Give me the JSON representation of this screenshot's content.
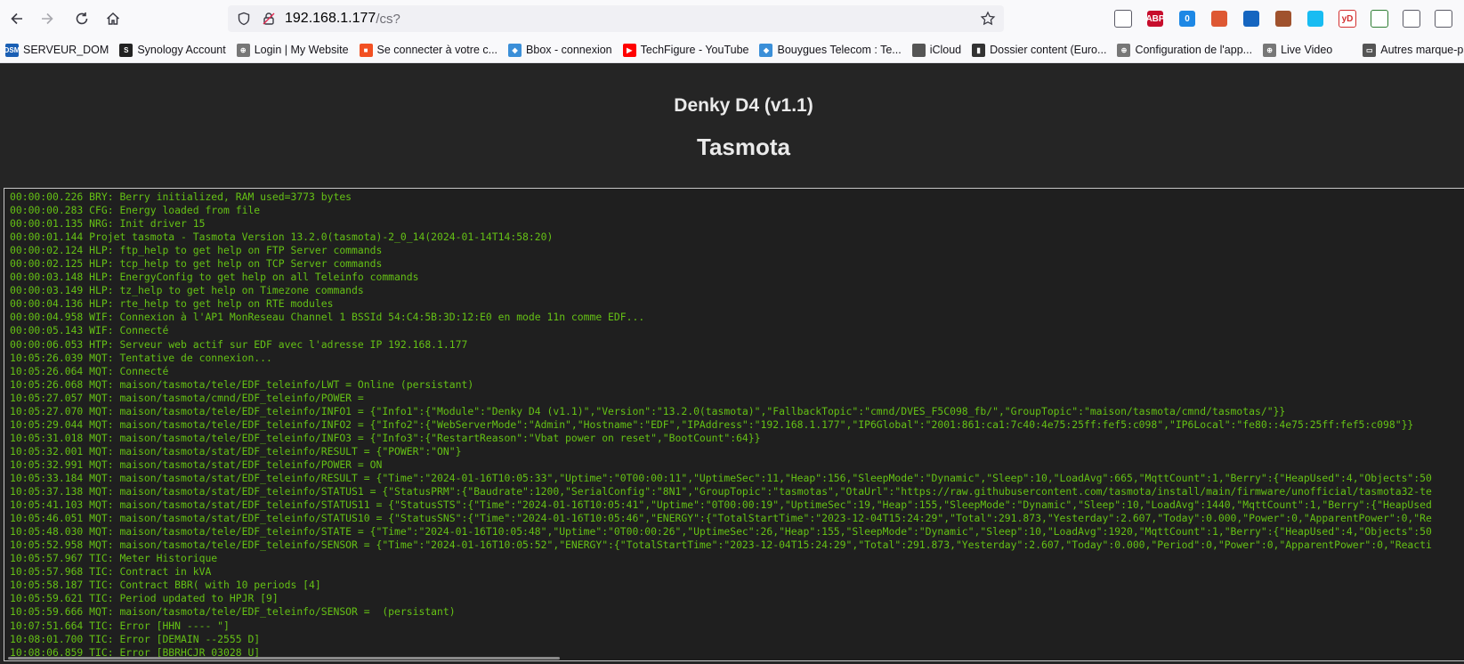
{
  "browser": {
    "url_host": "192.168.1.177",
    "url_path": "/cs?",
    "extensions": [
      {
        "name": "pocket-icon",
        "label": "",
        "color": "#ffffff",
        "fg": "#5b5b66"
      },
      {
        "name": "adblock-icon",
        "label": "ABP",
        "color": "#c70d2c",
        "fg": "#ffffff"
      },
      {
        "name": "clipboard-extension-icon",
        "label": "0",
        "color": "#1e88e5",
        "fg": "#ffffff"
      },
      {
        "name": "duckduckgo-icon",
        "label": "",
        "color": "#de5833",
        "fg": "#ffffff"
      },
      {
        "name": "network-extension-icon",
        "label": "",
        "color": "#1565c0",
        "fg": "#ffffff"
      },
      {
        "name": "sun-extension-icon",
        "label": "",
        "color": "#a0522d",
        "fg": "#ffffff"
      },
      {
        "name": "home-assistant-icon",
        "label": "",
        "color": "#18bcf2",
        "fg": "#ffffff"
      },
      {
        "name": "youtube-downloader-icon",
        "label": "yD",
        "color": "#ffffff",
        "fg": "#d32f2f"
      },
      {
        "name": "download-arrow-icon",
        "label": "",
        "color": "#ffffff",
        "fg": "#2e7d32"
      },
      {
        "name": "sync-icon",
        "label": "",
        "color": "#ffffff",
        "fg": "#5b5b66"
      },
      {
        "name": "extensions-puzzle-icon",
        "label": "",
        "color": "#ffffff",
        "fg": "#5b5b66"
      }
    ]
  },
  "bookmarks": [
    {
      "label": "SERVEUR_DOM",
      "color": "#1a5fb4",
      "badge": "DSM"
    },
    {
      "label": "Synology Account",
      "color": "#222222",
      "badge": "S"
    },
    {
      "label": "Login | My Website",
      "color": "#777777",
      "badge": "⊕"
    },
    {
      "label": "Se connecter à votre c...",
      "color": "#f25022",
      "badge": "■"
    },
    {
      "label": "Bbox - connexion",
      "color": "#3b8fd8",
      "badge": "◆"
    },
    {
      "label": "TechFigure - YouTube",
      "color": "#ff0000",
      "badge": "▶"
    },
    {
      "label": "Bouygues Telecom : Te...",
      "color": "#3b8fd8",
      "badge": "◆"
    },
    {
      "label": "iCloud",
      "color": "#555555",
      "badge": ""
    },
    {
      "label": "Dossier content (Euro...",
      "color": "#333333",
      "badge": "▮"
    },
    {
      "label": "Configuration de l'app...",
      "color": "#777777",
      "badge": "⊕"
    },
    {
      "label": "Live Video",
      "color": "#777777",
      "badge": "⊕"
    },
    {
      "label": "Autres marque-pa",
      "color": "#555555",
      "badge": "▭"
    }
  ],
  "page": {
    "device_name": "Denky D4 (v1.1)",
    "title": "Tasmota"
  },
  "console": {
    "lines": [
      "00:00:00.226 BRY: Berry initialized, RAM used=3773 bytes",
      "00:00:00.283 CFG: Energy loaded from file",
      "00:00:01.135 NRG: Init driver 15",
      "00:00:01.144 Projet tasmota - Tasmota Version 13.2.0(tasmota)-2_0_14(2024-01-14T14:58:20)",
      "00:00:02.124 HLP: ftp_help to get help on FTP Server commands",
      "00:00:02.125 HLP: tcp_help to get help on TCP Server commands",
      "00:00:03.148 HLP: EnergyConfig to get help on all Teleinfo commands",
      "00:00:03.149 HLP: tz_help to get help on Timezone commands",
      "00:00:04.136 HLP: rte_help to get help on RTE modules",
      "00:00:04.958 WIF: Connexion à l'AP1 MonReseau Channel 1 BSSId 54:C4:5B:3D:12:E0 en mode 11n comme EDF...",
      "00:00:05.143 WIF: Connecté",
      "00:00:06.053 HTP: Serveur web actif sur EDF avec l'adresse IP 192.168.1.177",
      "10:05:26.039 MQT: Tentative de connexion...",
      "10:05:26.064 MQT: Connecté",
      "10:05:26.068 MQT: maison/tasmota/tele/EDF_teleinfo/LWT = Online (persistant)",
      "10:05:27.057 MQT: maison/tasmota/cmnd/EDF_teleinfo/POWER =",
      "10:05:27.070 MQT: maison/tasmota/tele/EDF_teleinfo/INFO1 = {\"Info1\":{\"Module\":\"Denky D4 (v1.1)\",\"Version\":\"13.2.0(tasmota)\",\"FallbackTopic\":\"cmnd/DVES_F5C098_fb/\",\"GroupTopic\":\"maison/tasmota/cmnd/tasmotas/\"}}",
      "10:05:29.044 MQT: maison/tasmota/tele/EDF_teleinfo/INFO2 = {\"Info2\":{\"WebServerMode\":\"Admin\",\"Hostname\":\"EDF\",\"IPAddress\":\"192.168.1.177\",\"IP6Global\":\"2001:861:ca1:7c40:4e75:25ff:fef5:c098\",\"IP6Local\":\"fe80::4e75:25ff:fef5:c098\"}}",
      "10:05:31.018 MQT: maison/tasmota/tele/EDF_teleinfo/INFO3 = {\"Info3\":{\"RestartReason\":\"Vbat power on reset\",\"BootCount\":64}}",
      "10:05:32.001 MQT: maison/tasmota/stat/EDF_teleinfo/RESULT = {\"POWER\":\"ON\"}",
      "10:05:32.991 MQT: maison/tasmota/stat/EDF_teleinfo/POWER = ON",
      "10:05:33.184 MQT: maison/tasmota/stat/EDF_teleinfo/RESULT = {\"Time\":\"2024-01-16T10:05:33\",\"Uptime\":\"0T00:00:11\",\"UptimeSec\":11,\"Heap\":156,\"SleepMode\":\"Dynamic\",\"Sleep\":10,\"LoadAvg\":665,\"MqttCount\":1,\"Berry\":{\"HeapUsed\":4,\"Objects\":50",
      "10:05:37.138 MQT: maison/tasmota/stat/EDF_teleinfo/STATUS1 = {\"StatusPRM\":{\"Baudrate\":1200,\"SerialConfig\":\"8N1\",\"GroupTopic\":\"tasmotas\",\"OtaUrl\":\"https://raw.githubusercontent.com/tasmota/install/main/firmware/unofficial/tasmota32-te",
      "10:05:41.103 MQT: maison/tasmota/stat/EDF_teleinfo/STATUS11 = {\"StatusSTS\":{\"Time\":\"2024-01-16T10:05:41\",\"Uptime\":\"0T00:00:19\",\"UptimeSec\":19,\"Heap\":155,\"SleepMode\":\"Dynamic\",\"Sleep\":10,\"LoadAvg\":1440,\"MqttCount\":1,\"Berry\":{\"HeapUsed",
      "10:05:46.051 MQT: maison/tasmota/stat/EDF_teleinfo/STATUS10 = {\"StatusSNS\":{\"Time\":\"2024-01-16T10:05:46\",\"ENERGY\":{\"TotalStartTime\":\"2023-12-04T15:24:29\",\"Total\":291.873,\"Yesterday\":2.607,\"Today\":0.000,\"Power\":0,\"ApparentPower\":0,\"Re",
      "10:05:48.030 MQT: maison/tasmota/tele/EDF_teleinfo/STATE = {\"Time\":\"2024-01-16T10:05:48\",\"Uptime\":\"0T00:00:26\",\"UptimeSec\":26,\"Heap\":155,\"SleepMode\":\"Dynamic\",\"Sleep\":10,\"LoadAvg\":1920,\"MqttCount\":1,\"Berry\":{\"HeapUsed\":4,\"Objects\":50",
      "10:05:52.958 MQT: maison/tasmota/tele/EDF_teleinfo/SENSOR = {\"Time\":\"2024-01-16T10:05:52\",\"ENERGY\":{\"TotalStartTime\":\"2023-12-04T15:24:29\",\"Total\":291.873,\"Yesterday\":2.607,\"Today\":0.000,\"Period\":0,\"Power\":0,\"ApparentPower\":0,\"Reacti",
      "10:05:57.967 TIC: Meter Historique",
      "10:05:57.968 TIC: Contract in kVA",
      "10:05:58.187 TIC: Contract BBR( with 10 periods [4]",
      "10:05:59.621 TIC: Period updated to HPJR [9]",
      "10:05:59.666 MQT: maison/tasmota/tele/EDF_teleinfo/SENSOR =  (persistant)",
      "10:07:51.664 TIC: Error [HHN ---- \"]",
      "10:08:01.700 TIC: Error [DEMAIN --2555 D]",
      "10:08:06.859 TIC: Error [BBRHCJR 03028 U]"
    ]
  }
}
